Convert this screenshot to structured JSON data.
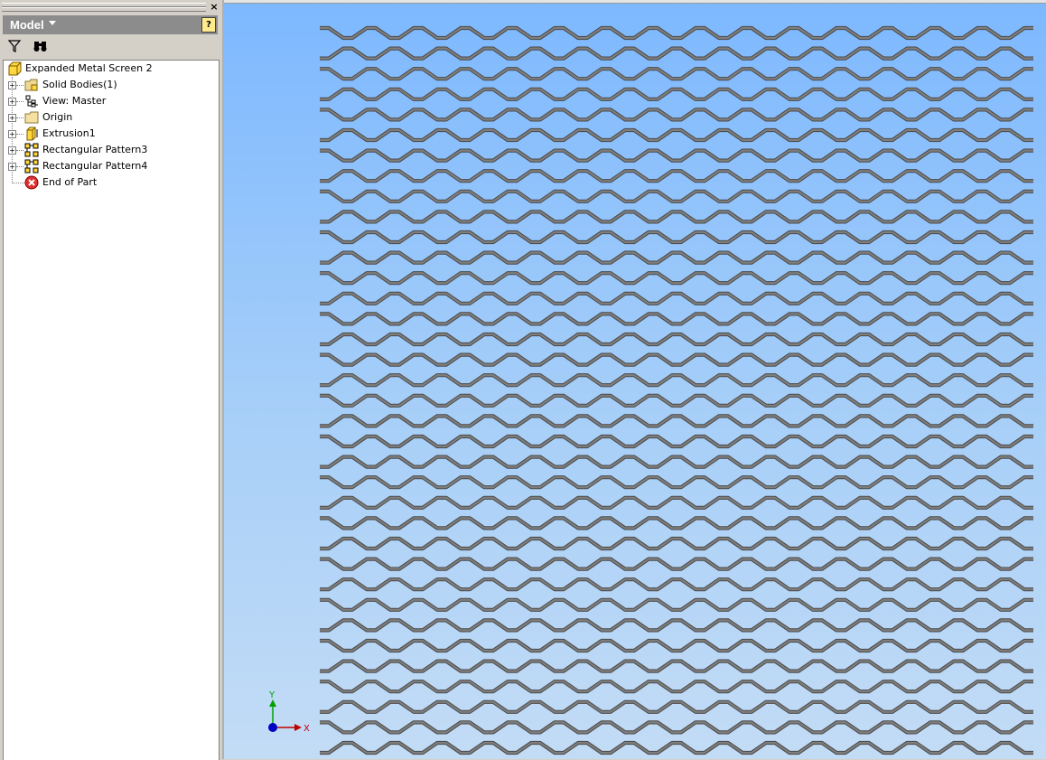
{
  "panel": {
    "title": "Model",
    "close_glyph": "×",
    "help_glyph": "?",
    "toolbar": {
      "filter_icon": "filter-icon",
      "find_icon": "binoculars-icon"
    }
  },
  "tree": {
    "root": {
      "label": "Expanded Metal Screen 2",
      "icon": "part-icon"
    },
    "items": [
      {
        "label": "Solid Bodies(1)",
        "icon": "solid-bodies-folder-icon",
        "expandable": true
      },
      {
        "label": "View: Master",
        "icon": "view-rep-icon",
        "expandable": true
      },
      {
        "label": "Origin",
        "icon": "folder-icon",
        "expandable": true
      },
      {
        "label": "Extrusion1",
        "icon": "extrusion-icon",
        "expandable": true
      },
      {
        "label": "Rectangular Pattern3",
        "icon": "rectangular-pattern-icon",
        "expandable": true
      },
      {
        "label": "Rectangular Pattern4",
        "icon": "rectangular-pattern-icon",
        "expandable": true
      },
      {
        "label": "End of Part",
        "icon": "end-of-part-icon",
        "expandable": false
      }
    ]
  },
  "viewport": {
    "axis_x_label": "X",
    "axis_y_label": "Y",
    "colors": {
      "mesh_stroke": "#4a4a4a",
      "mesh_fill": "#7e7e7e",
      "axis_x": "#c00000",
      "axis_y": "#00a000",
      "axis_origin": "#0000c0"
    }
  }
}
